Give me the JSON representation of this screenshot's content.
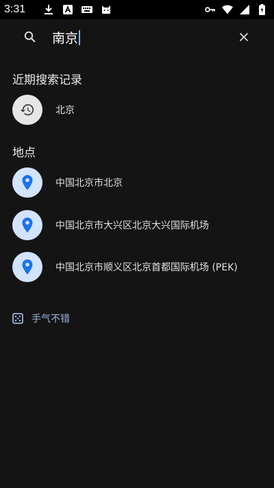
{
  "status_bar": {
    "time": "3:31",
    "left_icons": [
      "download-icon",
      "font-app-icon",
      "keyboard-icon",
      "cat-app-icon"
    ],
    "right_icons": [
      "vpn-key-icon",
      "wifi-icon",
      "signal-icon",
      "battery-charging-icon"
    ]
  },
  "search": {
    "query": "南京",
    "icon": "search-icon",
    "clear_icon": "close-icon"
  },
  "recent": {
    "title": "近期搜索记录",
    "items": [
      {
        "label": "北京",
        "icon": "history-icon"
      }
    ]
  },
  "places": {
    "title": "地点",
    "items": [
      {
        "label": "中国北京市北京",
        "icon": "location-pin-icon"
      },
      {
        "label": "中国北京市大兴区北京大兴国际机场",
        "icon": "location-pin-icon"
      },
      {
        "label": "中国北京市顺义区北京首都国际机场 (PEK)",
        "icon": "location-pin-icon"
      }
    ]
  },
  "lucky": {
    "label": "手气不错",
    "icon": "dice-icon"
  },
  "colors": {
    "background": "#141414",
    "status_bar": "#000000",
    "accent": "#8ab4f8",
    "pin": "#1a73e8",
    "place_icon_bg": "#d2e3fc",
    "history_icon_bg": "#e6e6e6"
  }
}
